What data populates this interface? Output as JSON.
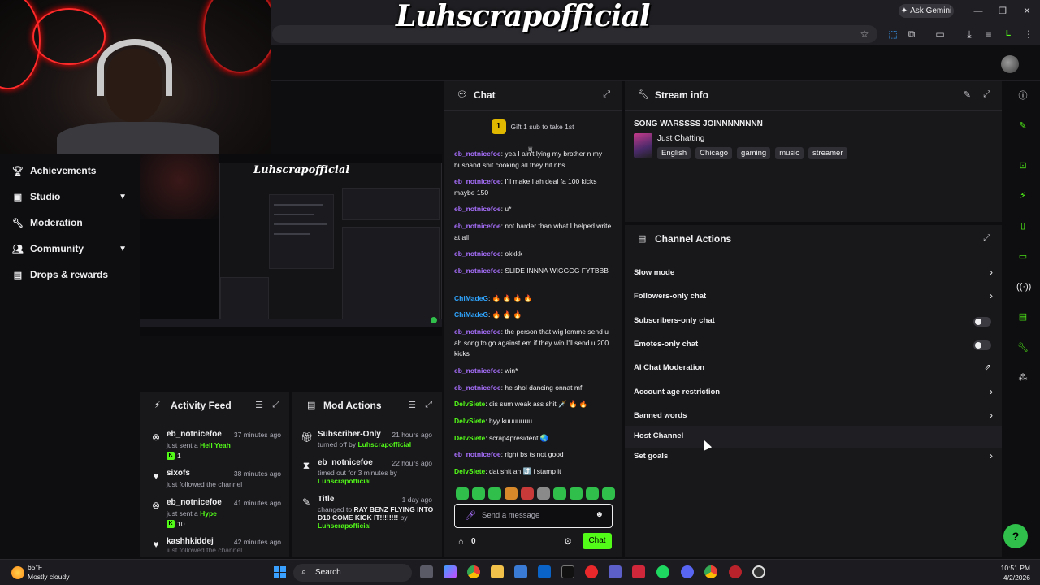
{
  "browser": {
    "ask_gemini": "Ask Gemini",
    "overlay_title": "Luhscrapofficial",
    "win_controls": [
      "—",
      "❐",
      "✕"
    ],
    "toolbar_icons": [
      "☆",
      "⬚",
      "⧉",
      "▭",
      "⤓",
      "≡",
      "L",
      "⋮"
    ]
  },
  "sidebar": {
    "items": [
      {
        "label": "Achievements",
        "icon": "trophy-icon"
      },
      {
        "label": "Studio",
        "icon": "studio-icon",
        "expandable": true
      },
      {
        "label": "Moderation",
        "icon": "wrench-icon"
      },
      {
        "label": "Community",
        "icon": "community-icon",
        "expandable": true
      },
      {
        "label": "Drops & rewards",
        "icon": "gift-icon"
      }
    ]
  },
  "preview": {
    "mini_title": "Luhscrapofficial"
  },
  "activity_feed": {
    "title": "Activity Feed",
    "items": [
      {
        "icon": "kick-icon",
        "name": "eb_notnicefoe",
        "time": "37 minutes ago",
        "action": "just sent a",
        "highlight": "Hell Yeah",
        "count": "1"
      },
      {
        "icon": "heart-icon",
        "name": "sixofs",
        "time": "38 minutes ago",
        "action": "just followed the channel",
        "highlight": "",
        "count": ""
      },
      {
        "icon": "kick-icon",
        "name": "eb_notnicefoe",
        "time": "41 minutes ago",
        "action": "just sent a",
        "highlight": "Hype",
        "count": "10"
      },
      {
        "icon": "heart-icon",
        "name": "kashhkiddej",
        "time": "42 minutes ago",
        "action": "just followed the channel",
        "highlight": "",
        "count": ""
      }
    ]
  },
  "mod_actions": {
    "title": "Mod Actions",
    "items": [
      {
        "icon": "gift-icon",
        "title": "Subscriber-Only",
        "time": "21 hours ago",
        "body": "turned off by",
        "by": "Luhscrapofficial",
        "body2": ""
      },
      {
        "icon": "hourglass-icon",
        "title": "eb_notnicefoe",
        "time": "22 hours ago",
        "body": "timed out for 3 minutes by",
        "by": "Luhscrapofficial",
        "body2": ""
      },
      {
        "icon": "edit-icon",
        "title": "Title",
        "time": "1 day ago",
        "body": "changed to",
        "highlight": "RAY BENZ FLYING INTO D10 COME KICK IT!!!!!!!!",
        "body2": "by",
        "by": "Luhscrapofficial"
      }
    ]
  },
  "chat": {
    "title": "Chat",
    "gift_badge": "1",
    "gift_text": "Gift 1 sub to take 1st",
    "messages": [
      {
        "user": "eb_notnicefoe",
        "color": "purple",
        "text": ": yea I ain't lying my brother n my husband shit cooking all they hit nbs"
      },
      {
        "user": "eb_notnicefoe",
        "color": "purple",
        "text": ": I'll make I ah deal fa 100 kicks maybe 150"
      },
      {
        "user": "eb_notnicefoe",
        "color": "purple",
        "text": ": u*"
      },
      {
        "user": "eb_notnicefoe",
        "color": "purple",
        "text": ": not harder than what I helped write at all"
      },
      {
        "user": "eb_notnicefoe",
        "color": "purple",
        "text": ": okkkk"
      },
      {
        "user": "eb_notnicefoe",
        "color": "purple",
        "text": ": SLIDE INNNA WIGGGG FYTBBB"
      },
      {
        "user": "ChiMadeG",
        "color": "blue",
        "text": ": 🔥 🔥 🔥 🔥"
      },
      {
        "user": "ChiMadeG",
        "color": "blue",
        "text": ": 🔥 🔥 🔥"
      },
      {
        "user": "eb_notnicefoe",
        "color": "purple",
        "text": ": the person that wig lemme send u ah song to go against em if they win I'll send u 200 kicks"
      },
      {
        "user": "eb_notnicefoe",
        "color": "purple",
        "text": ": win*"
      },
      {
        "user": "eb_notnicefoe",
        "color": "purple",
        "text": ": he shol dancing onnat mf"
      },
      {
        "user": "DelvSiete",
        "color": "green",
        "text": ": dis sum weak ass shit 🗡️ 🔥 🔥"
      },
      {
        "user": "DelvSiete",
        "color": "green",
        "text": ": hyy kuuuuuuu"
      },
      {
        "user": "DelvSiete",
        "color": "green",
        "text": ": scrap4president 🌏"
      },
      {
        "user": "eb_notnicefoe",
        "color": "purple",
        "text": ": right bs ts not good"
      },
      {
        "user": "DelvSiete",
        "color": "green",
        "text": ": dat shit ah ⤴️ i stamp it"
      }
    ],
    "input_placeholder": "Send a message",
    "points": "0",
    "send_label": "Chat"
  },
  "stream_info": {
    "title": "Stream info",
    "stream_title": "SONG WARSSSS JOINNNNNNNN",
    "category": "Just Chatting",
    "tags": [
      "English",
      "Chicago",
      "gaming",
      "music",
      "streamer"
    ]
  },
  "channel_actions": {
    "title": "Channel Actions",
    "rows": [
      {
        "label": "Slow mode",
        "control": "chevron"
      },
      {
        "label": "Followers-only chat",
        "control": "chevron"
      },
      {
        "label": "Subscribers-only chat",
        "control": "toggle"
      },
      {
        "label": "Emotes-only chat",
        "control": "toggle"
      },
      {
        "label": "AI Chat Moderation",
        "control": "external"
      },
      {
        "label": "Account age restriction",
        "control": "chevron"
      },
      {
        "label": "Banned words",
        "control": "chevron"
      },
      {
        "label": "Host Channel",
        "control": "none"
      },
      {
        "label": "Set goals",
        "control": "chevron"
      }
    ]
  },
  "taskbar": {
    "temp": "65°F",
    "weather": "Mostly cloudy",
    "search_placeholder": "Search",
    "time": "10:51 PM",
    "date": "4/2/2026"
  },
  "colors": {
    "accent": "#53fc18",
    "bg": "#0e0e10",
    "panel": "#18181b"
  }
}
